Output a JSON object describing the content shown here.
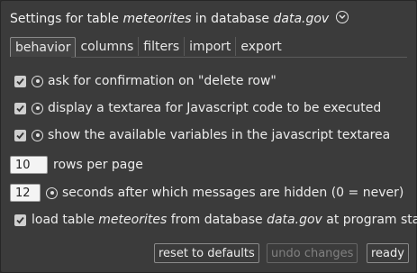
{
  "dialog": {
    "title_prefix": "Settings for table ",
    "table_name": "meteorites",
    "title_middle": " in database ",
    "database_name": "data.gov"
  },
  "tabs": [
    {
      "label": "behavior",
      "active": true
    },
    {
      "label": "columns",
      "active": false
    },
    {
      "label": "filters",
      "active": false
    },
    {
      "label": "import",
      "active": false
    },
    {
      "label": "export",
      "active": false
    }
  ],
  "options": {
    "confirm_delete": {
      "checked": true,
      "label": "ask for confirmation on \"delete row\""
    },
    "js_textarea": {
      "checked": true,
      "label": "display a textarea for Javascript code to be executed"
    },
    "show_variables": {
      "checked": true,
      "label": "show the available variables in the javascript textarea"
    },
    "rows_per_page": {
      "value": "10",
      "label": "rows per page"
    },
    "message_seconds": {
      "value": "12",
      "label": "seconds after which messages are hidden (0 = never)"
    },
    "load_on_start": {
      "checked": true,
      "label_prefix": "load table ",
      "table_name": "meteorites",
      "label_middle": " from database ",
      "database_name": "data.gov",
      "label_suffix": " at program start"
    }
  },
  "buttons": {
    "reset": "reset to defaults",
    "undo": "undo changes",
    "ready": "ready"
  }
}
